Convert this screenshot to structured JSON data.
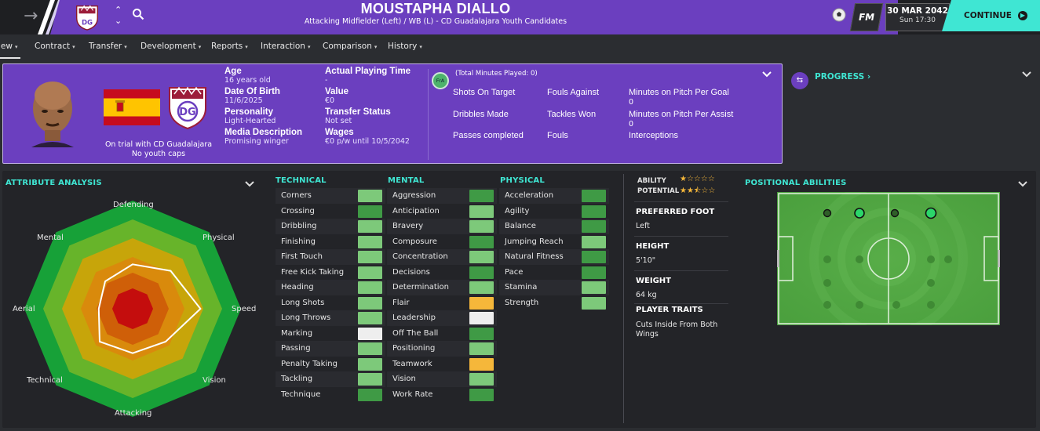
{
  "header": {
    "player_name": "MOUSTAPHA DIALLO",
    "player_subtitle": "Attacking Midfielder (Left) / WB (L) - CD Guadalajara Youth Candidates",
    "fm_label": "FM",
    "date": "30 MAR 2042",
    "time": "Sun 17:30",
    "continue_label": "CONTINUE",
    "icons": {
      "back": "arrow-right-icon",
      "club": "club-badge-icon",
      "updown": "up-down-icon",
      "search": "search-icon",
      "ball": "ball-icon"
    }
  },
  "tabs": [
    {
      "label": "iew"
    },
    {
      "label": "Contract"
    },
    {
      "label": "Transfer"
    },
    {
      "label": "Development"
    },
    {
      "label": "Reports"
    },
    {
      "label": "Interaction"
    },
    {
      "label": "Comparison"
    },
    {
      "label": "History"
    }
  ],
  "profile": {
    "trial_line1": "On trial with CD Guadalajara",
    "trial_line2": "No youth caps",
    "age_label": "Age",
    "age_value": "16 years old",
    "dob_label": "Date Of Birth",
    "dob_value": "11/6/2025",
    "personality_label": "Personality",
    "personality_value": "Light-Hearted",
    "media_label": "Media Description",
    "media_value": "Promising winger",
    "apt_label": "Actual Playing Time",
    "apt_value": "-",
    "value_label": "Value",
    "value_value": "€0",
    "transfer_label": "Transfer Status",
    "transfer_value": "Not set",
    "wages_label": "Wages",
    "wages_value": "€0 p/w until 10/5/2042",
    "match_stats": {
      "badge": "FrA",
      "total_minutes": "(Total Minutes Played: 0)",
      "shots_on_target": "Shots On Target",
      "dribbles_made": "Dribbles Made",
      "passes_completed": "Passes completed",
      "fouls_against": "Fouls Against",
      "tackles_won": "Tackles Won",
      "fouls": "Fouls",
      "min_per_goal": "Minutes on Pitch Per Goal",
      "min_per_goal_value": "0",
      "min_per_assist": "Minutes on Pitch Per Assist",
      "min_per_assist_value": "0",
      "interceptions": "Interceptions"
    }
  },
  "progress": {
    "label": "PROGRESS ›"
  },
  "attribute_analysis": {
    "title": "ATTRIBUTE ANALYSIS",
    "labels": {
      "defending": "Defending",
      "physical": "Physical",
      "speed": "Speed",
      "vision": "Vision",
      "attacking": "Attacking",
      "technical": "Technical",
      "aerial": "Aerial",
      "mental": "Mental"
    },
    "colors": {
      "ring1": "#17a138",
      "ring2": "#67b42a",
      "ring3": "#c7a50a",
      "ring4": "#d98a0c",
      "ring5": "#cf5f08",
      "ring6": "#c40d0d",
      "outline": "#ffffff"
    }
  },
  "technical": {
    "title": "TECHNICAL",
    "items": [
      {
        "name": "Corners",
        "color": "#7dc97a"
      },
      {
        "name": "Crossing",
        "color": "#3f9a45"
      },
      {
        "name": "Dribbling",
        "color": "#7dc97a"
      },
      {
        "name": "Finishing",
        "color": "#7dc97a"
      },
      {
        "name": "First Touch",
        "color": "#7dc97a"
      },
      {
        "name": "Free Kick Taking",
        "color": "#7dc97a"
      },
      {
        "name": "Heading",
        "color": "#7dc97a"
      },
      {
        "name": "Long Shots",
        "color": "#7dc97a"
      },
      {
        "name": "Long Throws",
        "color": "#7dc97a"
      },
      {
        "name": "Marking",
        "color": "#eeeeee"
      },
      {
        "name": "Passing",
        "color": "#7dc97a"
      },
      {
        "name": "Penalty Taking",
        "color": "#7dc97a"
      },
      {
        "name": "Tackling",
        "color": "#7dc97a"
      },
      {
        "name": "Technique",
        "color": "#3f9a45"
      }
    ]
  },
  "mental": {
    "title": "MENTAL",
    "items": [
      {
        "name": "Aggression",
        "color": "#3f9a45"
      },
      {
        "name": "Anticipation",
        "color": "#7dc97a"
      },
      {
        "name": "Bravery",
        "color": "#7dc97a"
      },
      {
        "name": "Composure",
        "color": "#3f9a45"
      },
      {
        "name": "Concentration",
        "color": "#7dc97a"
      },
      {
        "name": "Decisions",
        "color": "#3f9a45"
      },
      {
        "name": "Determination",
        "color": "#7dc97a"
      },
      {
        "name": "Flair",
        "color": "#f5b73a"
      },
      {
        "name": "Leadership",
        "color": "#eeeeee"
      },
      {
        "name": "Off The Ball",
        "color": "#3f9a45"
      },
      {
        "name": "Positioning",
        "color": "#7dc97a"
      },
      {
        "name": "Teamwork",
        "color": "#f5b73a"
      },
      {
        "name": "Vision",
        "color": "#7dc97a"
      },
      {
        "name": "Work Rate",
        "color": "#3f9a45"
      }
    ]
  },
  "physical": {
    "title": "PHYSICAL",
    "items": [
      {
        "name": "Acceleration",
        "color": "#3f9a45"
      },
      {
        "name": "Agility",
        "color": "#3f9a45"
      },
      {
        "name": "Balance",
        "color": "#3f9a45"
      },
      {
        "name": "Jumping Reach",
        "color": "#7dc97a"
      },
      {
        "name": "Natural Fitness",
        "color": "#3f9a45"
      },
      {
        "name": "Pace",
        "color": "#3f9a45"
      },
      {
        "name": "Stamina",
        "color": "#7dc97a"
      },
      {
        "name": "Strength",
        "color": "#7dc97a"
      }
    ]
  },
  "player_info": {
    "ability_label": "ABILITY",
    "ability_stars": "★☆☆☆☆",
    "potential_label": "POTENTIAL",
    "potential_stars": "★★⯪☆☆",
    "preferred_foot_label": "PREFERRED FOOT",
    "preferred_foot_value": "Left",
    "height_label": "HEIGHT",
    "height_value": "5'10\"",
    "weight_label": "WEIGHT",
    "weight_value": "64 kg",
    "traits_label": "PLAYER TRAITS",
    "traits_value": "Cuts Inside From Both Wings"
  },
  "positional": {
    "title": "POSITIONAL ABILITIES",
    "pitch_color": "#5aae4a"
  }
}
